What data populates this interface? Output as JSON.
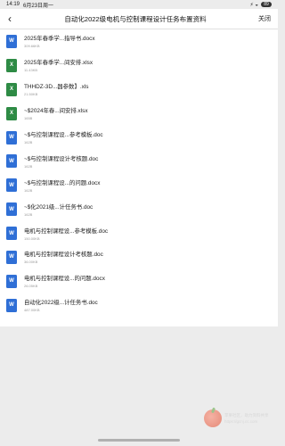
{
  "status_bar": {
    "time": "14:19",
    "date": "6月23日周一",
    "signal": "⚡ ◒",
    "battery": "89"
  },
  "header": {
    "back_icon": "‹",
    "title": "自动化2022级电机与控制课程设计任务布置资料",
    "close_label": "关闭"
  },
  "files": [
    {
      "type": "doc",
      "name": "2025年春季学...指导书.docx",
      "size": "309.66KB"
    },
    {
      "type": "xls",
      "name": "2025年春季学...间安排.xlsx",
      "size": "11.43KB"
    },
    {
      "type": "xls",
      "name": "THHDZ-3D...器参数】.xls",
      "size": "21.50KB"
    },
    {
      "type": "xls",
      "name": "~$2024年春...间安排.xlsx",
      "size": "165B"
    },
    {
      "type": "doc",
      "name": "~$与控制课程设...参考模板.doc",
      "size": "162B"
    },
    {
      "type": "doc",
      "name": "~$与控制课程设计考核题.doc",
      "size": "162B"
    },
    {
      "type": "doc",
      "name": "~$与控制课程设...的问题.docx",
      "size": "162B"
    },
    {
      "type": "doc",
      "name": "~$化2021级...计任务书.doc",
      "size": "162B"
    },
    {
      "type": "doc",
      "name": "电机与控制课程设...参考模板.doc",
      "size": "150.00KB"
    },
    {
      "type": "doc",
      "name": "电机与控制课程设计考核题.doc",
      "size": "36.00KB"
    },
    {
      "type": "doc",
      "name": "电机与控制课程设...的问题.docx",
      "size": "26.05KB"
    },
    {
      "type": "doc",
      "name": "自动化2022级...计任务书.doc",
      "size": "487.00KB"
    }
  ],
  "watermark": {
    "line1": "苹果社区，助力资料共享",
    "line2": "https://gcnj.cc.com"
  },
  "colors": {
    "doc": "#2f6fd6",
    "xls": "#2e8b45",
    "background": "#ececec"
  }
}
